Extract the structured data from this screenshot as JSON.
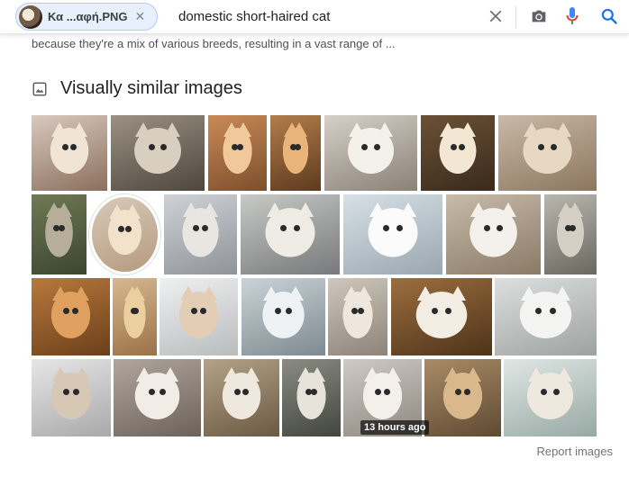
{
  "search": {
    "chip_label": "Κα ...αφή.PNG",
    "chip_close": "✕",
    "query": "domestic short-haired cat"
  },
  "snippet": "because they're a mix of various breeds, resulting in a vast range of ...",
  "section": {
    "title": "Visually similar images",
    "icon": "image-icon"
  },
  "colors": {
    "mic_blue": "#4285f4",
    "mic_red": "#ea4335",
    "search_blue": "#1a73e8",
    "grey_icon": "#5f6368"
  },
  "images": [
    {
      "name": "cat-img-1",
      "a": "#d9c9bf",
      "b": "#8b6f5c",
      "c": "#f1e4d6"
    },
    {
      "name": "cat-img-2",
      "a": "#9a9183",
      "b": "#4f463d",
      "c": "#d9cfc1"
    },
    {
      "name": "cat-img-3",
      "a": "#c98a57",
      "b": "#7c4f2c",
      "c": "#f0c89a"
    },
    {
      "name": "cat-img-4",
      "a": "#b17e4c",
      "b": "#5e3a1e",
      "c": "#e9b47a"
    },
    {
      "name": "cat-img-5",
      "a": "#d6d0c8",
      "b": "#8a8178",
      "c": "#f4f0ea"
    },
    {
      "name": "cat-img-6",
      "a": "#6b5136",
      "b": "#3a2a1b",
      "c": "#f3e6d2"
    },
    {
      "name": "cat-img-7",
      "a": "#c9b9a6",
      "b": "#8c7660",
      "c": "#e7d8c4"
    },
    {
      "name": "cat-img-8",
      "a": "#6f7a55",
      "b": "#3c4530",
      "c": "#b7ae9a"
    },
    {
      "name": "cat-img-9",
      "a": "#d8c9b8",
      "b": "#b59b80",
      "c": "#f2e2cc"
    },
    {
      "name": "cat-img-10",
      "a": "#cfd2d6",
      "b": "#8f949a",
      "c": "#e9e6e1"
    },
    {
      "name": "cat-img-11",
      "a": "#c7cac7",
      "b": "#77797a",
      "c": "#efece6"
    },
    {
      "name": "cat-img-12",
      "a": "#d7e0e6",
      "b": "#9aa7b0",
      "c": "#fbfbfb"
    },
    {
      "name": "cat-img-13",
      "a": "#c8bba9",
      "b": "#8a7a66",
      "c": "#f4f1ec"
    },
    {
      "name": "cat-img-14",
      "a": "#b8b6ae",
      "b": "#6b6860",
      "c": "#d6d0c4"
    },
    {
      "name": "cat-img-15",
      "a": "#b8793c",
      "b": "#6b3f1a",
      "c": "#e0a060"
    },
    {
      "name": "cat-img-16",
      "a": "#d6b890",
      "b": "#9b7148",
      "c": "#ebcf9f"
    },
    {
      "name": "cat-img-17",
      "a": "#eef0f1",
      "b": "#b9bcbd",
      "c": "#e3cdb4"
    },
    {
      "name": "cat-img-18",
      "a": "#c9d3d8",
      "b": "#7f8a90",
      "c": "#eef2f4"
    },
    {
      "name": "cat-img-19",
      "a": "#cfc7bd",
      "b": "#8d8377",
      "c": "#efe7dc"
    },
    {
      "name": "cat-img-20",
      "a": "#9c6e3e",
      "b": "#4d3319",
      "c": "#f3ede4"
    },
    {
      "name": "cat-img-21",
      "a": "#dcdfde",
      "b": "#9da3a1",
      "c": "#f4f4f2"
    },
    {
      "name": "cat-img-22",
      "a": "#e6e6e6",
      "b": "#a9a9a9",
      "c": "#d7c7b5"
    },
    {
      "name": "cat-img-23",
      "a": "#b0a69d",
      "b": "#6d625a",
      "c": "#f1ece6"
    },
    {
      "name": "cat-img-24",
      "a": "#b4a288",
      "b": "#6b5a42",
      "c": "#efe8de"
    },
    {
      "name": "cat-img-25",
      "a": "#8a8c84",
      "b": "#43463e",
      "c": "#e7e2da"
    },
    {
      "name": "cat-img-26",
      "a": "#cfcac4",
      "b": "#8e8780",
      "c": "#f3efea"
    },
    {
      "name": "cat-img-27",
      "a": "#a98b67",
      "b": "#5f4a31",
      "c": "#d9b98c"
    },
    {
      "name": "cat-img-28",
      "a": "#dfe7e4",
      "b": "#98a9a4",
      "c": "#efe8de"
    }
  ],
  "badge_text": "13 hours ago",
  "report_link": "Report images"
}
